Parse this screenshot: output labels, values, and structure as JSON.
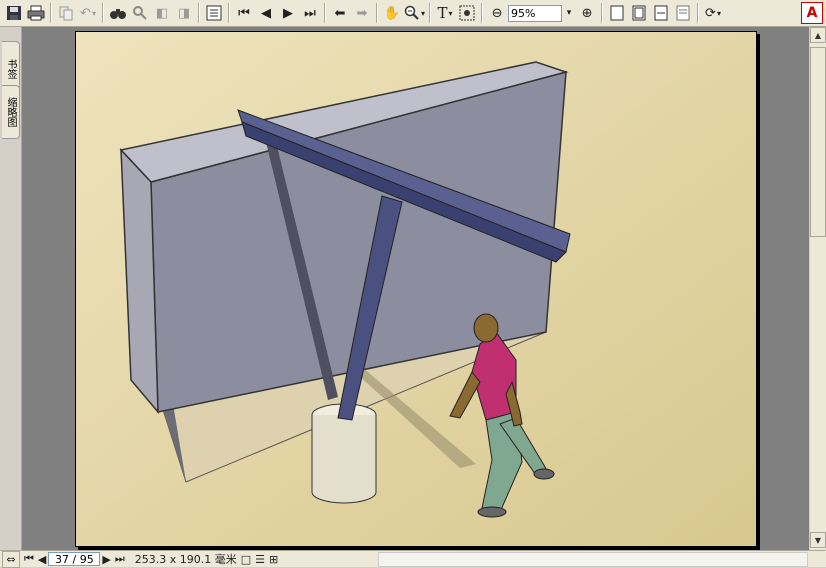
{
  "toolbar": {
    "zoom_value": "95%",
    "text_select_label": "T",
    "logo_text": "A"
  },
  "left_pane": {
    "tab_bookmarks": "书签",
    "tab_thumbnails": "缩略图"
  },
  "status_bar": {
    "page_indicator": "37 / 95",
    "page_size": "253.3 x 190.1 毫米"
  },
  "colors": {
    "toolbar_bg": "#ece9d8",
    "doc_bg": "#808080",
    "page_bg": "#e8dcb0",
    "wall": "#8c8ea0",
    "beam": "#4a5080",
    "shirt": "#c03070",
    "pants": "#80a890"
  },
  "icons": [
    "save-icon",
    "print-icon",
    "copy-icon",
    "undo-icon",
    "find-icon",
    "search-icon",
    "prev-doc-icon",
    "next-doc-icon",
    "properties-icon",
    "first-page-icon",
    "prev-page-icon",
    "next-page-icon",
    "last-page-icon",
    "go-back-icon",
    "go-forward-icon",
    "hand-tool-icon",
    "zoom-tool-icon",
    "text-select-icon",
    "snapshot-icon",
    "zoom-out-icon",
    "zoom-in-icon",
    "actual-size-icon",
    "fit-page-icon",
    "fit-width-icon",
    "reflow-icon",
    "rotate-icon"
  ]
}
